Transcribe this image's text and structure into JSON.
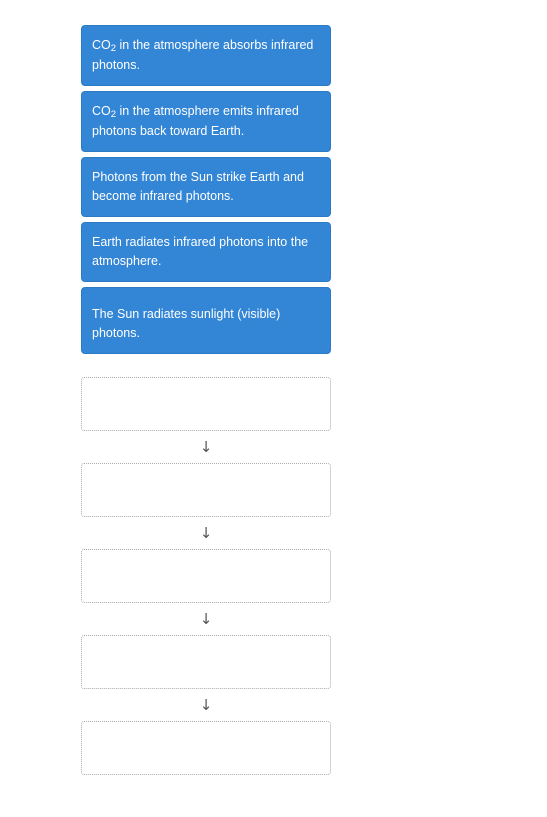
{
  "background_color": "#ffffff",
  "cards": {
    "accent_color": "#3385d6",
    "border_color": "#2a7ac4",
    "text_color": "#ffffff",
    "items": [
      {
        "id": "card-co2-absorbs",
        "text_before": "CO",
        "subscript": "2",
        "text_after": " in the atmosphere absorbs infrared photons.",
        "full_text": "CO2 in the atmosphere absorbs infrared photons."
      },
      {
        "id": "card-co2-emits",
        "text_before": "CO",
        "subscript": "2",
        "text_after": " in the atmosphere emits infrared photons back toward Earth.",
        "full_text": "CO2 in the atmosphere emits infrared photons back toward Earth."
      },
      {
        "id": "card-photons-strike",
        "text_before": "Photons from the Sun strike Earth and become infrared photons.",
        "subscript": "",
        "text_after": "",
        "full_text": "Photons from the Sun strike Earth and become infrared photons."
      },
      {
        "id": "card-earth-radiates",
        "text_before": "Earth radiates infrared photons into the atmosphere.",
        "subscript": "",
        "text_after": "",
        "full_text": "Earth radiates infrared photons into the atmosphere."
      },
      {
        "id": "card-sun-radiates",
        "text_before": "The Sun radiates sunlight (visible) photons.",
        "subscript": "",
        "text_after": "",
        "full_text": "The Sun radiates sunlight (visible) photons."
      }
    ]
  },
  "dropzones": {
    "border_color": "#a9a9a9",
    "fill_color": "#ffffff",
    "count": 5,
    "slots": [
      {
        "id": "dropzone-1",
        "value": ""
      },
      {
        "id": "dropzone-2",
        "value": ""
      },
      {
        "id": "dropzone-3",
        "value": ""
      },
      {
        "id": "dropzone-4",
        "value": ""
      },
      {
        "id": "dropzone-5",
        "value": ""
      }
    ]
  },
  "arrows": {
    "glyph": "↓",
    "color": "#555555",
    "count": 4
  }
}
